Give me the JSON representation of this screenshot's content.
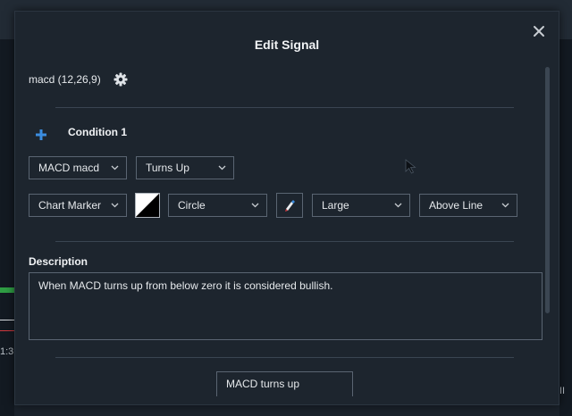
{
  "modal": {
    "title": "Edit Signal",
    "signal_name": "macd (12,26,9)"
  },
  "condition": {
    "label": "Condition 1",
    "indicator": "MACD macd",
    "operator": "Turns Up",
    "action": "Chart Marker",
    "shape": "Circle",
    "size": "Large",
    "position": "Above Line"
  },
  "description": {
    "label": "Description",
    "text": "When MACD turns up from below zero it is considered bullish."
  },
  "marker_label": "MACD turns up",
  "background": {
    "tick_text": "1:3",
    "right_glyph": "II"
  },
  "colors": {
    "accent": "#3b8de0",
    "swatch_primary": "#000000",
    "swatch_secondary": "#ffffff"
  },
  "icons": [
    "close-icon",
    "gear-icon",
    "plus-icon",
    "chevron-down-icon",
    "marker-color-icon"
  ]
}
